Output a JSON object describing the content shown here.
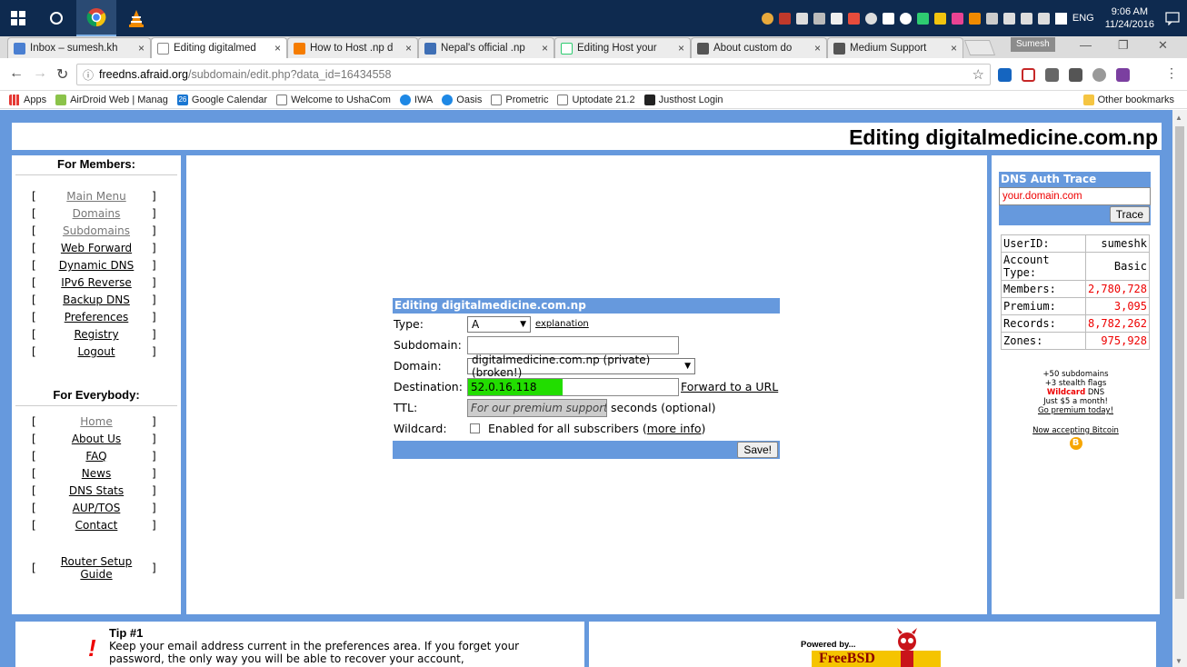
{
  "taskbar": {
    "clock_time": "9:06 AM",
    "clock_date": "11/24/2016",
    "language": "ENG"
  },
  "tabs": [
    {
      "label": "Inbox – sumesh.kh",
      "close": "×",
      "color": "#4a7fd1"
    },
    {
      "label": "Editing digitalmed",
      "close": "×",
      "color": "#ffffff"
    },
    {
      "label": "How to Host .np d",
      "close": "×",
      "color": "#f57c00"
    },
    {
      "label": "Nepal's official .np",
      "close": "×",
      "color": "#3f6fb5"
    },
    {
      "label": "Editing Host your",
      "close": "×",
      "color": "#2ecc71"
    },
    {
      "label": "About custom do",
      "close": "×",
      "color": "#555555"
    },
    {
      "label": "Medium Support",
      "close": "×",
      "color": "#555555"
    }
  ],
  "profile_name": "Sumesh",
  "address": {
    "host": "freedns.afraid.org",
    "path": "/subdomain/edit.php?data_id=16434558"
  },
  "bookmarks": [
    {
      "label": "Apps",
      "icon": "apps-icon"
    },
    {
      "label": "AirDroid Web | Manag",
      "icon": "airdroid-icon"
    },
    {
      "label": "Google Calendar",
      "icon": "calendar-icon",
      "badge": "26"
    },
    {
      "label": "Welcome to UshaCom",
      "icon": "page-icon"
    },
    {
      "label": "IWA",
      "icon": "globe-icon"
    },
    {
      "label": "Oasis",
      "icon": "globe-icon"
    },
    {
      "label": "Prometric",
      "icon": "page-icon"
    },
    {
      "label": "Uptodate 21.2",
      "icon": "page-icon"
    },
    {
      "label": "Justhost Login",
      "icon": "justhost-icon"
    }
  ],
  "other_bookmarks": "Other bookmarks",
  "page": {
    "title": "Editing digitalmedicine.com.np",
    "members_heading": "For Members:",
    "members_menu": [
      "Main Menu",
      "Domains",
      "Subdomains",
      "Web Forward",
      "Dynamic DNS",
      "IPv6 Reverse",
      "Backup DNS",
      "Preferences",
      "Registry",
      "Logout"
    ],
    "everybody_heading": "For Everybody:",
    "everybody_menu": [
      "Home",
      "About Us",
      "FAQ",
      "News",
      "DNS Stats",
      "AUP/TOS",
      "Contact"
    ],
    "router_guide": "Router Setup Guide",
    "bracket_open": "[",
    "bracket_close": "]"
  },
  "form": {
    "heading": "Editing digitalmedicine.com.np",
    "type_label": "Type:",
    "type_value": "A",
    "explanation_link": "explanation",
    "subdomain_label": "Subdomain:",
    "subdomain_value": "",
    "domain_label": "Domain:",
    "domain_value": "digitalmedicine.com.np (private) (broken!)",
    "destination_label": "Destination:",
    "destination_value": "52.0.16.118",
    "forward_link": "Forward to a URL",
    "ttl_label": "TTL:",
    "ttl_placeholder": "For our premium supporters",
    "ttl_suffix": "seconds (optional)",
    "wildcard_label": "Wildcard:",
    "wildcard_text": "Enabled for all subscribers (",
    "wildcard_link": "more info",
    "wildcard_close": ")",
    "save_label": "Save!"
  },
  "dns_trace": {
    "heading": "DNS Auth Trace",
    "input_value": "your.domain.com",
    "button": "Trace"
  },
  "stats": [
    {
      "label": "UserID:",
      "value": "sumeshk"
    },
    {
      "label": "Account Type:",
      "value": "Basic"
    },
    {
      "label": "Members:",
      "value": "2,780,728"
    },
    {
      "label": "Premium:",
      "value": "3,095"
    },
    {
      "label": "Records:",
      "value": "8,782,262"
    },
    {
      "label": "Zones:",
      "value": "975,928"
    }
  ],
  "promo": {
    "line1": "+50 subdomains",
    "line2": "+3 stealth flags",
    "wildcard_word": "Wildcard",
    "dns_word": " DNS",
    "line4": "Just $5 a month!",
    "link": "Go premium today!",
    "bitcoin": "Now accepting Bitcoin",
    "bitcoin_glyph": "B"
  },
  "tip": {
    "heading": "Tip #1",
    "text": "Keep your email address current in the preferences area. If you forget your password, the only way you will be able to recover your account,",
    "icon": "!"
  },
  "powered": {
    "line1": "Powered by...",
    "logo_text": "FreeBSD"
  },
  "colors": {
    "frame": "#6699dd",
    "highlight": "#22dd00"
  }
}
